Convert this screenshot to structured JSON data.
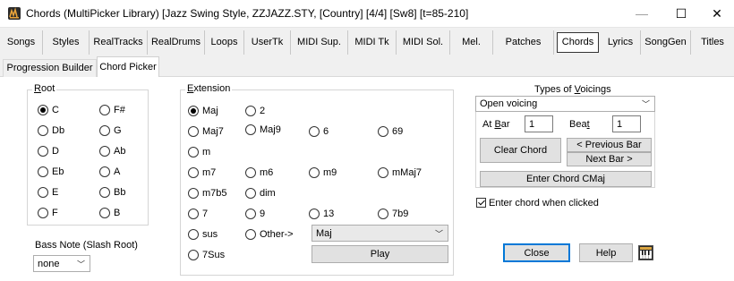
{
  "window": {
    "title": "Chords  (MultiPicker Library)  [Jazz Swing Style, ZZJAZZ.STY,  [Country] [4/4] [Sw8] [t=85-210]",
    "min_glyph": "—",
    "max_glyph": "☐",
    "close_glyph": "✕"
  },
  "tabs": [
    "Songs",
    "Styles",
    "RealTracks",
    "RealDrums",
    "Loops",
    "UserTk",
    "MIDI Sup.",
    "MIDI Tk",
    "MIDI Sol.",
    "Mel.",
    "Patches",
    "Chords",
    "Lyrics",
    "SongGen",
    "Titles"
  ],
  "active_tab": "Chords",
  "subtabs": [
    "Progression Builder",
    "Chord Picker"
  ],
  "active_subtab": "Chord Picker",
  "root": {
    "label_ul": "R",
    "label_rest": "oot",
    "options": [
      "C",
      "F#",
      "Db",
      "G",
      "D",
      "Ab",
      "Eb",
      "A",
      "E",
      "Bb",
      "F",
      "B"
    ],
    "selected": "C"
  },
  "bass_note": {
    "label": "Bass Note (Slash Root)",
    "value": "none"
  },
  "extension": {
    "label_ul": "E",
    "label_rest": "xtension",
    "options": [
      "Maj",
      "2",
      "Maj7",
      "Maj9",
      "6",
      "69",
      "m",
      "m7",
      "m6",
      "m9",
      "mMaj7",
      "m7b5",
      "dim",
      "7",
      "9",
      "13",
      "7b9",
      "sus",
      "Other->",
      "7Sus"
    ],
    "selected": "Maj",
    "other_value": "Maj"
  },
  "play_label": "Play",
  "voicings": {
    "label_pre": "Types of ",
    "label_ul": "V",
    "label_post": "oicings",
    "value": "Open voicing",
    "at_bar_pre": "At ",
    "at_bar_ul": "B",
    "at_bar_post": "ar",
    "at_bar_value": "1",
    "beat_pre": "Bea",
    "beat_ul": "t",
    "beat_value": "1",
    "clear_chord": "Clear Chord",
    "previous_bar": "< Previous Bar",
    "next_bar": "Next Bar >",
    "enter_chord": "Enter Chord CMaj",
    "enter_when_clicked": "Enter chord when clicked"
  },
  "close_label": "Close",
  "help_label": "Help",
  "colors": {
    "accent": "#0078d7",
    "chrome": "#f0f0f0"
  }
}
